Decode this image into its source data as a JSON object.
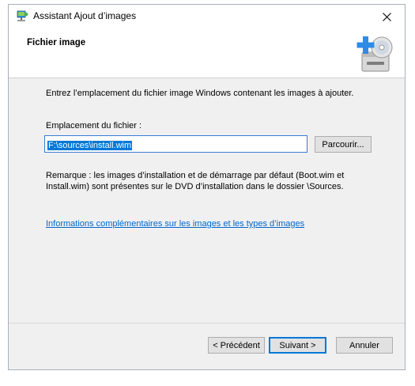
{
  "window": {
    "title": "Assistant Ajout d’images",
    "app_icon": "network-computer-icon",
    "close_icon": "close-icon"
  },
  "header": {
    "title": "Fichier image",
    "icon": "add-disc-drive-icon"
  },
  "content": {
    "intro": "Entrez l’emplacement du fichier image Windows contenant les images à ajouter.",
    "field_label": "Emplacement du fichier :",
    "path_value": "F:\\sources\\install.wim",
    "browse_label": "Parcourir...",
    "remark": "Remarque : les images d’installation et de démarrage par défaut (Boot.wim et Install.wim) sont présentes sur le DVD d’installation dans le dossier \\Sources.",
    "link": "Informations complémentaires sur les images et les types d’images"
  },
  "footer": {
    "prev_label": "< Précédent",
    "next_label": "Suivant >",
    "cancel_label": "Annuler"
  },
  "colors": {
    "link": "#0066cc",
    "selection": "#0078d7",
    "dialog_bg": "#f0f0f0"
  }
}
